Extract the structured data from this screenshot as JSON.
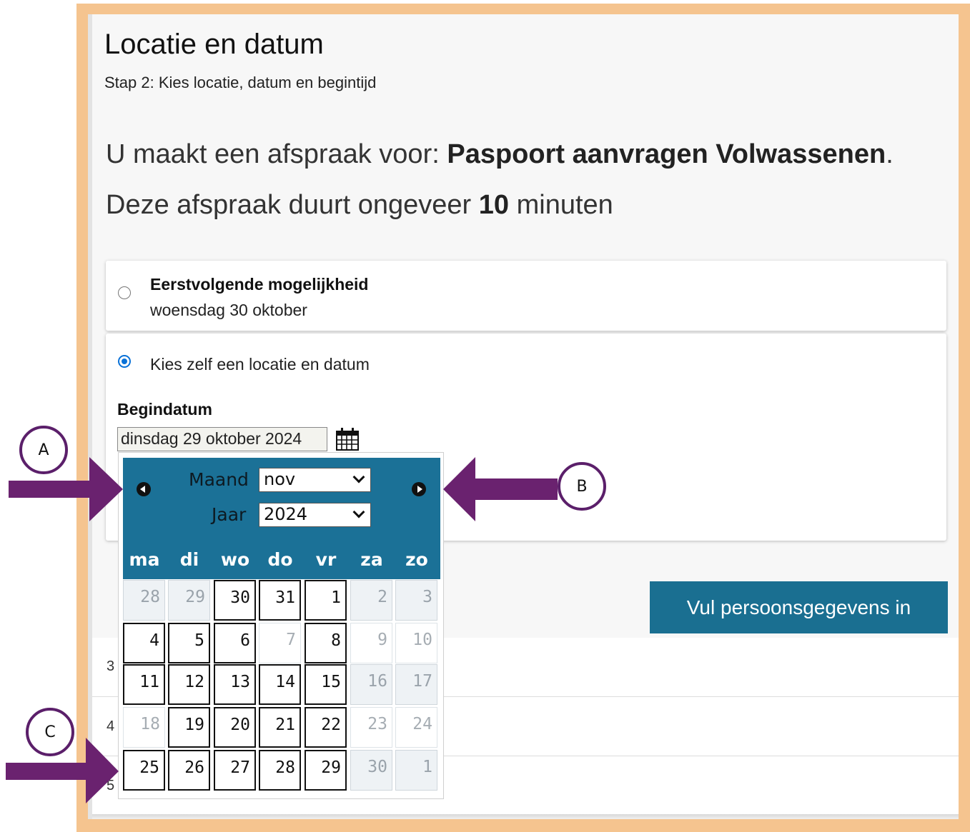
{
  "page": {
    "title": "Locatie en datum",
    "step": "Stap 2: Kies locatie, datum en begintijd",
    "appointment_prefix": "U maakt een afspraak voor: ",
    "appointment_name": "Paspoort aanvragen Volwassenen",
    "appointment_suffix": ".",
    "duration_prefix": "Deze afspraak duurt ongeveer ",
    "duration_value": "10",
    "duration_suffix": " minuten"
  },
  "options": {
    "first": {
      "title": "Eerstvolgende mogelijkheid",
      "subtitle": "woensdag 30 oktober",
      "checked": false
    },
    "custom": {
      "label": "Kies zelf een locatie en datum",
      "checked": true
    }
  },
  "form": {
    "start_date_label": "Begindatum",
    "start_date_value": "dinsdag 29 oktober 2024",
    "submit_label": "Vul persoonsgegevens in"
  },
  "lower_list": [
    "3",
    "4",
    "5"
  ],
  "datepicker": {
    "month_label": "Maand",
    "month_value": "nov",
    "year_label": "Jaar",
    "year_value": "2024",
    "weekdays": [
      "ma",
      "di",
      "wo",
      "do",
      "vr",
      "za",
      "zo"
    ],
    "weeks": [
      [
        {
          "d": "28",
          "s": "past"
        },
        {
          "d": "29",
          "s": "past"
        },
        {
          "d": "30",
          "s": "active"
        },
        {
          "d": "31",
          "s": "active"
        },
        {
          "d": "1",
          "s": "active"
        },
        {
          "d": "2",
          "s": "wk"
        },
        {
          "d": "3",
          "s": "wk"
        }
      ],
      [
        {
          "d": "4",
          "s": "active"
        },
        {
          "d": "5",
          "s": "active"
        },
        {
          "d": "6",
          "s": "active"
        },
        {
          "d": "7",
          "s": "dis"
        },
        {
          "d": "8",
          "s": "active"
        },
        {
          "d": "9",
          "s": "dis"
        },
        {
          "d": "10",
          "s": "dis"
        }
      ],
      [
        {
          "d": "11",
          "s": "active"
        },
        {
          "d": "12",
          "s": "active"
        },
        {
          "d": "13",
          "s": "active"
        },
        {
          "d": "14",
          "s": "active"
        },
        {
          "d": "15",
          "s": "active"
        },
        {
          "d": "16",
          "s": "wk"
        },
        {
          "d": "17",
          "s": "wk"
        }
      ],
      [
        {
          "d": "18",
          "s": "dis"
        },
        {
          "d": "19",
          "s": "active"
        },
        {
          "d": "20",
          "s": "active"
        },
        {
          "d": "21",
          "s": "active"
        },
        {
          "d": "22",
          "s": "active"
        },
        {
          "d": "23",
          "s": "dis"
        },
        {
          "d": "24",
          "s": "dis"
        }
      ],
      [
        {
          "d": "25",
          "s": "active"
        },
        {
          "d": "26",
          "s": "active"
        },
        {
          "d": "27",
          "s": "active"
        },
        {
          "d": "28",
          "s": "active"
        },
        {
          "d": "29",
          "s": "active"
        },
        {
          "d": "30",
          "s": "wk"
        },
        {
          "d": "1",
          "s": "wk"
        }
      ]
    ]
  },
  "annotations": {
    "a": "A",
    "b": "B",
    "c": "C",
    "arrow_color": "#6a226f"
  }
}
